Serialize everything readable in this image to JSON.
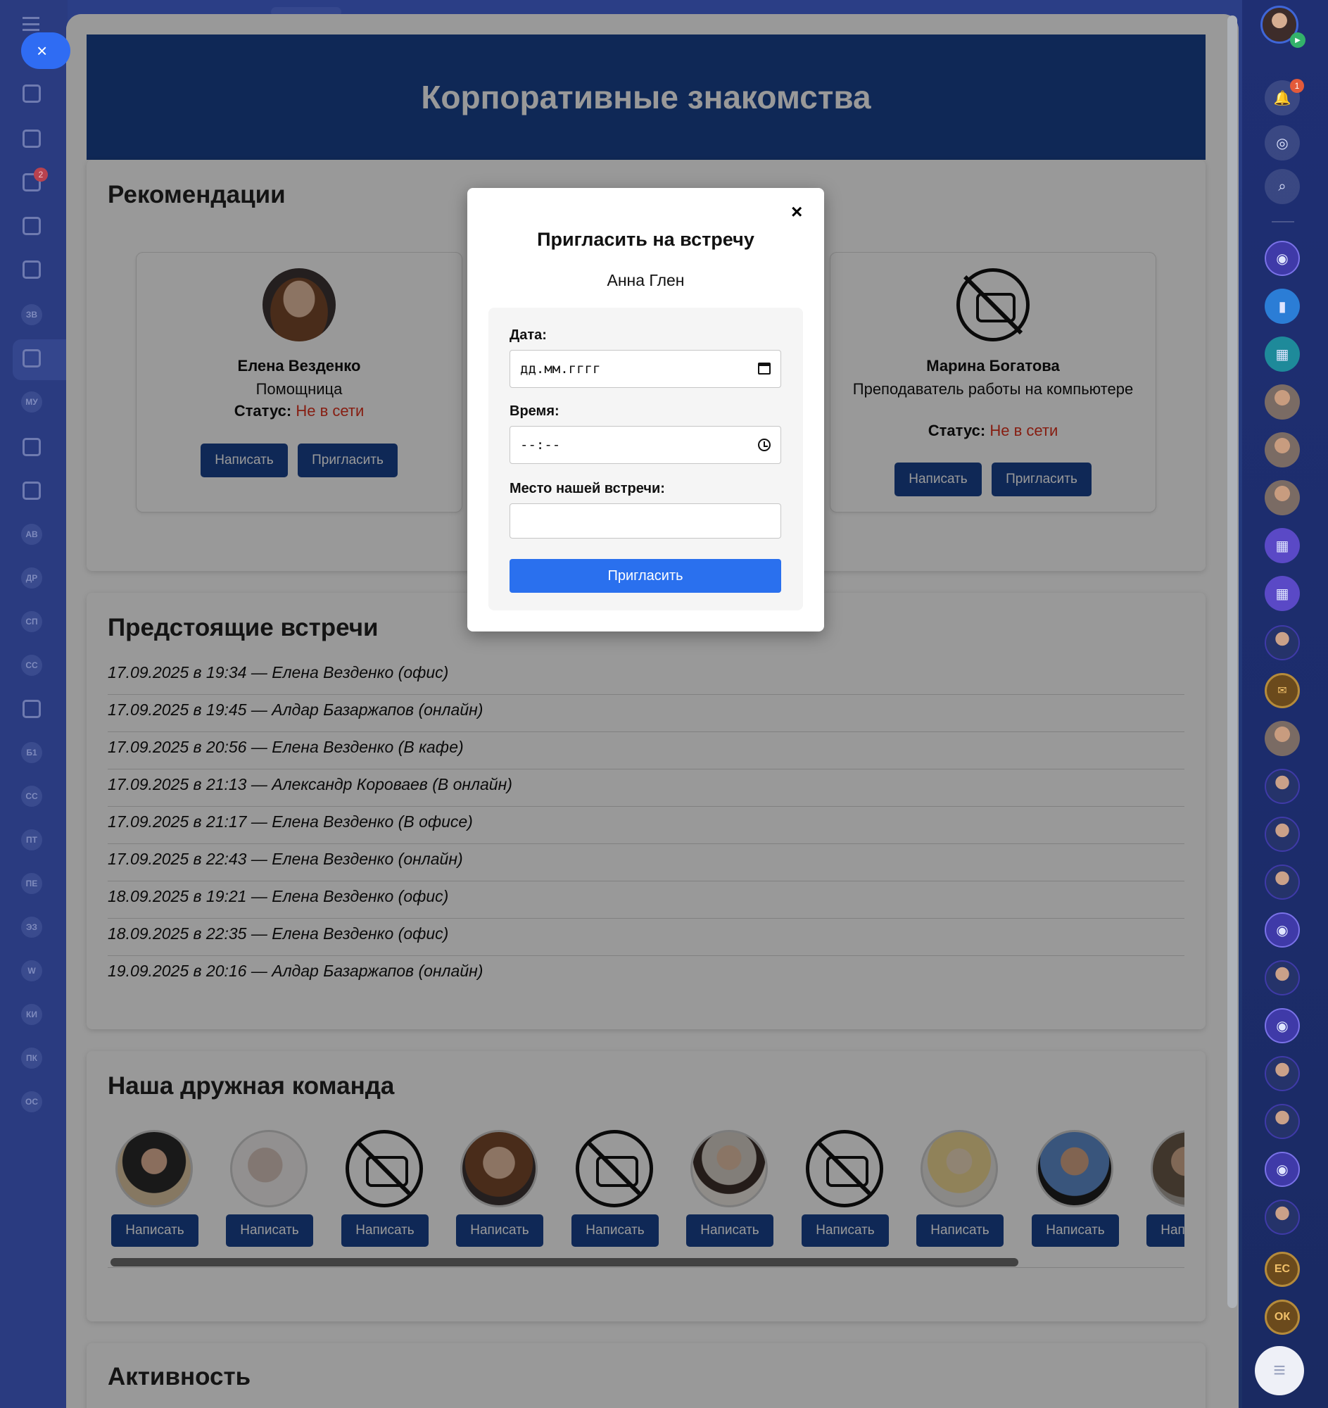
{
  "app": {
    "title": "Корпоративные знакомства"
  },
  "background_sidebar": {
    "badge_count": "2",
    "initials": [
      "ЗВ",
      "МУ",
      "АВ",
      "ДР",
      "СП",
      "СС",
      "Б1",
      "СС",
      "ПТ",
      "ПЕ",
      "ЭЗ",
      "W",
      "КИ",
      "ПК",
      "ОС"
    ]
  },
  "right_rail": {
    "notification_count": "1",
    "initials_1": "ЕС",
    "initials_2": "ОК"
  },
  "recommendations": {
    "title": "Рекомендации",
    "cards": [
      {
        "name": "Елена Везденко",
        "role": "Помощница",
        "status_label": "Статус:",
        "status_value": "Не в сети",
        "write_label": "Написать",
        "invite_label": "Пригласить"
      },
      {
        "name": "Марина Богатова",
        "role": "Преподаватель работы на компьютере",
        "status_label": "Статус:",
        "status_value": "Не в сети",
        "write_label": "Написать",
        "invite_label": "Пригласить"
      }
    ]
  },
  "meetings": {
    "title": "Предстоящие встречи",
    "items": [
      "17.09.2025 в 19:34 — Елена Везденко (офис)",
      "17.09.2025 в 19:45 — Алдар Базаржапов (онлайн)",
      "17.09.2025 в 20:56 — Елена Везденко (В кафе)",
      "17.09.2025 в 21:13 — Александр Короваев (В онлайн)",
      "17.09.2025 в 21:17 — Елена Везденко (В офисе)",
      "17.09.2025 в 22:43 — Елена Везденко (онлайн)",
      "18.09.2025 в 19:21 — Елена Везденко (офис)",
      "18.09.2025 в 22:35 — Елена Везденко (офис)",
      "19.09.2025 в 20:16 — Алдар Базаржапов (онлайн)"
    ]
  },
  "team": {
    "title": "Наша дружная команда",
    "write_label": "Написать",
    "members": [
      {
        "photo": "photo-a"
      },
      {
        "photo": "photo-b"
      },
      {
        "photo": "no-photo"
      },
      {
        "photo": "photo-c"
      },
      {
        "photo": "no-photo"
      },
      {
        "photo": "photo-d"
      },
      {
        "photo": "no-photo"
      },
      {
        "photo": "photo-e"
      },
      {
        "photo": "photo-f"
      },
      {
        "photo": "photo-g"
      }
    ]
  },
  "activity": {
    "title": "Активность"
  },
  "modal": {
    "title": "Пригласить на встречу",
    "person": "Анна Глен",
    "close_icon": "×",
    "date_label": "Дата:",
    "date_placeholder": "дд.мм.гггг",
    "time_label": "Время:",
    "time_placeholder": "--:--",
    "place_label": "Место нашей встречи:",
    "place_value": "",
    "submit_label": "Пригласить"
  },
  "colors": {
    "header_bg": "#1a438f",
    "button_bg": "#1a438f",
    "submit_bg": "#2a70ee",
    "status_offline": "#e0321f"
  }
}
